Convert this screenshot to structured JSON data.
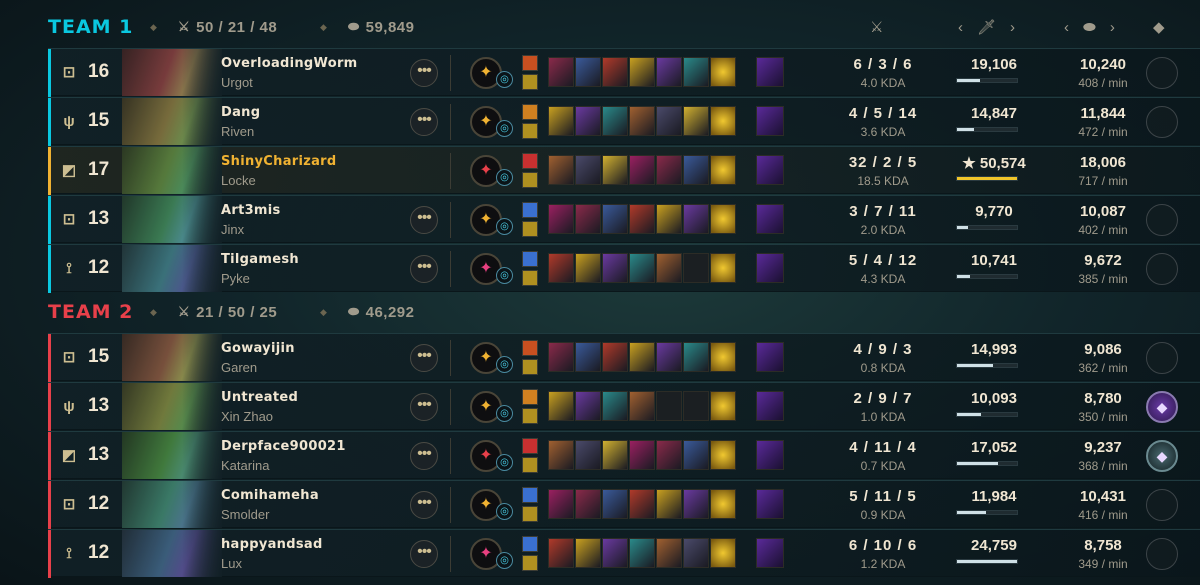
{
  "team1": {
    "name": "TEAM 1",
    "kda": "50 / 21 / 48",
    "gold": "59,849",
    "players": [
      {
        "role": "top",
        "level": "16",
        "name": "OverloadingWorm",
        "champion": "Urgot",
        "kda": "6 / 3 / 6",
        "ratio": "4.0 KDA",
        "damage": "19,106",
        "dmg_pct": 0.38,
        "gold": "10,240",
        "gpm": "408 / min",
        "me": false
      },
      {
        "role": "jungle",
        "level": "15",
        "name": "Dang",
        "champion": "Riven",
        "kda": "4 / 5 / 14",
        "ratio": "3.6 KDA",
        "damage": "14,847",
        "dmg_pct": 0.29,
        "gold": "11,844",
        "gpm": "472 / min",
        "me": false
      },
      {
        "role": "mid",
        "level": "17",
        "name": "ShinyCharizard",
        "champion": "Locke",
        "kda": "32 / 2 / 5",
        "ratio": "18.5 KDA",
        "damage": "★ 50,574",
        "dmg_pct": 1.0,
        "gold": "18,006",
        "gpm": "717 / min",
        "me": true
      },
      {
        "role": "bottom",
        "level": "13",
        "name": "Art3mis",
        "champion": "Jinx",
        "kda": "3 / 7 / 11",
        "ratio": "2.0 KDA",
        "damage": "9,770",
        "dmg_pct": 0.19,
        "gold": "10,087",
        "gpm": "402 / min",
        "me": false
      },
      {
        "role": "support",
        "level": "12",
        "name": "Tilgamesh",
        "champion": "Pyke",
        "kda": "5 / 4 / 12",
        "ratio": "4.3 KDA",
        "damage": "10,741",
        "dmg_pct": 0.21,
        "gold": "9,672",
        "gpm": "385 / min",
        "me": false
      }
    ]
  },
  "team2": {
    "name": "TEAM 2",
    "kda": "21 / 50 / 25",
    "gold": "46,292",
    "players": [
      {
        "role": "top",
        "level": "15",
        "name": "Gowayijin",
        "champion": "Garen",
        "kda": "4 / 9 / 3",
        "ratio": "0.8 KDA",
        "damage": "14,993",
        "dmg_pct": 0.6,
        "gold": "9,086",
        "gpm": "362 / min",
        "me": false
      },
      {
        "role": "jungle",
        "level": "13",
        "name": "Untreated",
        "champion": "Xin Zhao",
        "kda": "2 / 9 / 7",
        "ratio": "1.0 KDA",
        "damage": "10,093",
        "dmg_pct": 0.4,
        "gold": "8,780",
        "gpm": "350 / min",
        "me": false
      },
      {
        "role": "mid",
        "level": "13",
        "name": "Derpface900021",
        "champion": "Katarina",
        "kda": "4 / 11 / 4",
        "ratio": "0.7 KDA",
        "damage": "17,052",
        "dmg_pct": 0.69,
        "gold": "9,237",
        "gpm": "368 / min",
        "me": false
      },
      {
        "role": "top",
        "level": "12",
        "name": "Comihameha",
        "champion": "Smolder",
        "kda": "5 / 11 / 5",
        "ratio": "0.9 KDA",
        "damage": "11,984",
        "dmg_pct": 0.48,
        "gold": "10,431",
        "gpm": "416 / min",
        "me": false
      },
      {
        "role": "support",
        "level": "12",
        "name": "happyandsad",
        "champion": "Lux",
        "kda": "6 / 10 / 6",
        "ratio": "1.2 KDA",
        "damage": "24,759",
        "dmg_pct": 1.0,
        "gold": "8,758",
        "gpm": "349 / min",
        "me": false
      }
    ]
  },
  "columns": {
    "kda_icon": "crossed-swords-icon",
    "damage_icon": "sword-icon",
    "gold_icon": "coins-icon",
    "honor_icon": "gem-icon"
  },
  "colors": {
    "team1": "#0ac8e0",
    "team2": "#e8404a",
    "highlight": "#f0b232"
  },
  "glyphs": {
    "more": "•••",
    "star": "★",
    "prev": "‹",
    "honor": "◆",
    "role_top": "⊡",
    "role_jungle": "ψ",
    "role_mid": "◩",
    "role_bottom": "⊡",
    "role_support": "⟟"
  }
}
